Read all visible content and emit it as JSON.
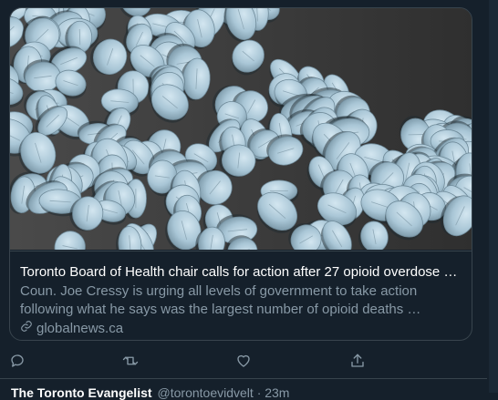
{
  "link_card": {
    "image_alt": "Light blue pills",
    "title": "Toronto Board of Health chair calls for action after 27 opioid overdose …",
    "description": "Coun. Joe Cressy is urging all levels of government to take action following what he says was the largest number of opioid deaths …",
    "domain": "globalnews.ca"
  },
  "actions": {
    "reply_icon": "reply-icon",
    "retweet_icon": "retweet-icon",
    "like_icon": "like-icon",
    "share_icon": "share-icon"
  },
  "next_tweet": {
    "name": "The Toronto Evangelist",
    "handle": "@torontoevidvelt · 23m"
  },
  "colors": {
    "background": "#15202b",
    "border": "#38444d",
    "secondary_text": "#8899a6",
    "pill": "#a9c6d6"
  }
}
